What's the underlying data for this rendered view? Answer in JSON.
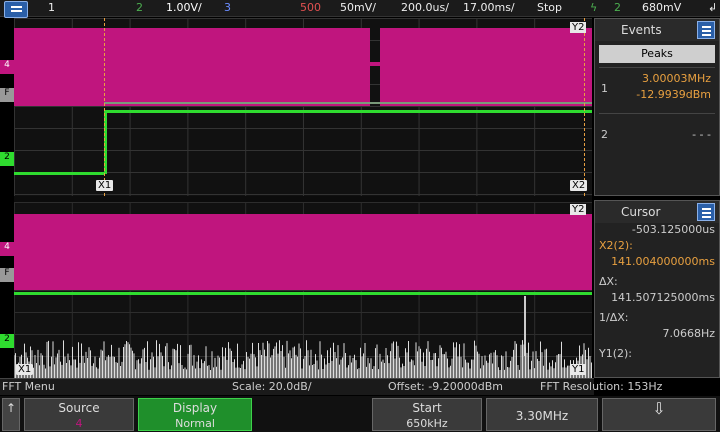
{
  "topbar": {
    "ch1": "1",
    "ch2": "2",
    "ch2_scale": "1.00V/",
    "ch3": "3",
    "math_label": "500",
    "scale2": "50mV/",
    "timebase": "200.0us/",
    "delay": "17.00ms/",
    "run_state": "Stop",
    "trig_ch": "2",
    "trig_level": "680mV"
  },
  "waveform": {
    "cursor_x1": "X1",
    "cursor_x2": "X2",
    "cursor_y2": "Y2",
    "cursor_y1": "Y1",
    "cursor_x1b": "X1"
  },
  "events_panel": {
    "title": "Events",
    "tab": "Peaks",
    "peaks": [
      {
        "index": "1",
        "freq": "3.00003MHz",
        "amp": "-12.9939dBm"
      },
      {
        "index": "2",
        "freq": "- - -",
        "amp": ""
      }
    ]
  },
  "cursor_panel": {
    "title": "Cursor",
    "x1_value": "-503.125000us",
    "x2_label": "X2(2):",
    "x2_value": "141.004000000ms",
    "dx_label": "ΔX:",
    "dx_value": "141.507125000ms",
    "inv_dx_label": "1/ΔX:",
    "inv_dx_value": "7.0668Hz",
    "y1_label": "Y1(2):"
  },
  "statusbar": {
    "menu": "FFT Menu",
    "scale": "Scale: 20.0dB/",
    "offset": "Offset: -9.20000dBm",
    "resolution": "FFT Resolution: 153Hz"
  },
  "softkeys": {
    "source_label": "Source",
    "source_value": "4",
    "display_label": "Display",
    "display_value": "Normal",
    "start_label": "Start",
    "start_value": "650kHz",
    "stop_value": "3.30MHz"
  }
}
